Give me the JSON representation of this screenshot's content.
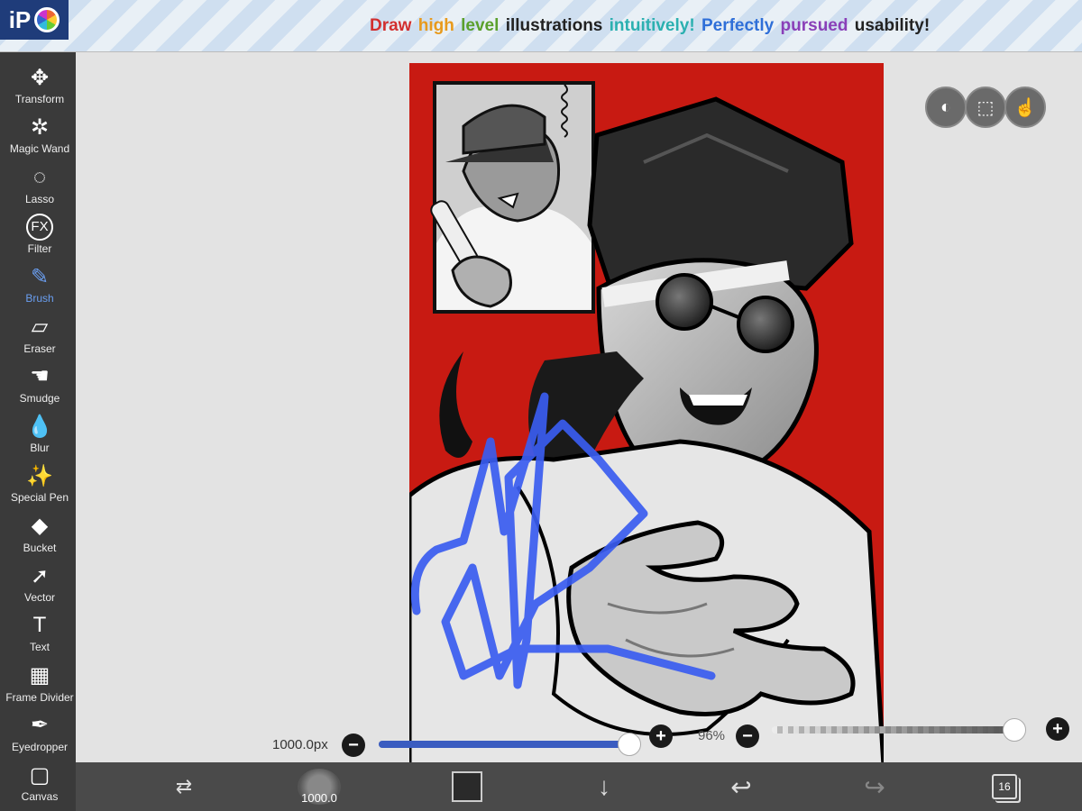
{
  "banner": {
    "words": [
      {
        "text": "Draw",
        "color": "#d22f2f"
      },
      {
        "text": "high",
        "color": "#e89a1c"
      },
      {
        "text": "level",
        "color": "#5aa02c"
      },
      {
        "text": "illustrations",
        "color": "#222222"
      },
      {
        "text": "intuitively!",
        "color": "#2bb0b0"
      },
      {
        "text": "Perfectly",
        "color": "#2f6fd8"
      },
      {
        "text": "pursued",
        "color": "#8a3fb8"
      },
      {
        "text": "usability!",
        "color": "#222222"
      }
    ]
  },
  "app": {
    "logo_text": "iP"
  },
  "toolbar": {
    "items": [
      {
        "label": "Transform",
        "icon": "✥",
        "icon_name": "move-arrows-icon"
      },
      {
        "label": "Magic Wand",
        "icon": "✲",
        "icon_name": "magic-wand-icon"
      },
      {
        "label": "Lasso",
        "icon": "◌",
        "icon_name": "lasso-icon"
      },
      {
        "label": "Filter",
        "icon": "FX",
        "icon_name": "fx-icon"
      },
      {
        "label": "Brush",
        "icon": "✎",
        "icon_name": "brush-icon"
      },
      {
        "label": "Eraser",
        "icon": "▱",
        "icon_name": "eraser-icon"
      },
      {
        "label": "Smudge",
        "icon": "☚",
        "icon_name": "smudge-icon"
      },
      {
        "label": "Blur",
        "icon": "💧",
        "icon_name": "blur-drop-icon"
      },
      {
        "label": "Special Pen",
        "icon": "✨",
        "icon_name": "special-pen-icon"
      },
      {
        "label": "Bucket",
        "icon": "◆",
        "icon_name": "bucket-icon"
      },
      {
        "label": "Vector",
        "icon": "➚",
        "icon_name": "vector-cursor-icon"
      },
      {
        "label": "Text",
        "icon": "T",
        "icon_name": "text-icon"
      },
      {
        "label": "Frame Divider",
        "icon": "▦",
        "icon_name": "frame-divider-icon"
      },
      {
        "label": "Eyedropper",
        "icon": "✒",
        "icon_name": "eyedropper-icon"
      },
      {
        "label": "Canvas",
        "icon": "▢",
        "icon_name": "canvas-icon"
      }
    ],
    "active": "Brush"
  },
  "slider": {
    "size_label": "1000.0px",
    "size_value": 0.96,
    "opacity_label": "96%",
    "opacity_value": 0.96
  },
  "bottombar": {
    "brush_size_label": "1000.0",
    "layers_count": "16"
  },
  "colors": {
    "accent": "#6a9ef0",
    "canvas_red": "#c81a12",
    "stroke_blue": "#3a5cf0"
  }
}
